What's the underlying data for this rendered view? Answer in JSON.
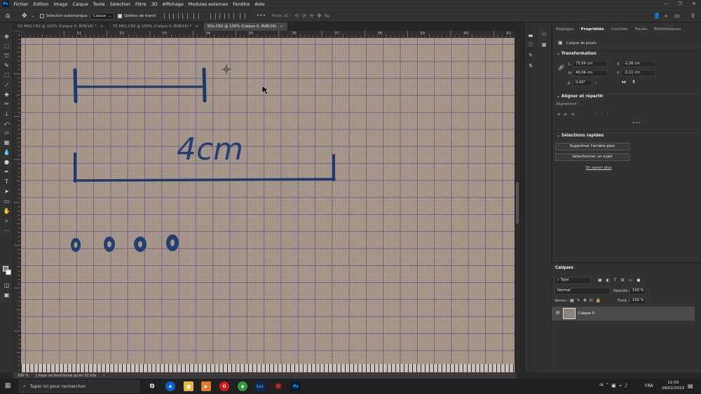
{
  "menu": [
    "Fichier",
    "Edition",
    "Image",
    "Calque",
    "Texte",
    "Sélection",
    "Filtre",
    "3D",
    "Affichage",
    "Modules externes",
    "Fenêtre",
    "Aide"
  ],
  "app_logo": "Ps",
  "options": {
    "auto_select_label": "Sélection automatique :",
    "auto_select_value": "Calque",
    "transform_label": "Options de transf.",
    "more": "•••",
    "mode3d_label": "Mode 3D :"
  },
  "tabs": [
    {
      "label": "5D MK2.CR2 @ 100% (Calque 0, RVB/16) *",
      "close": "×"
    },
    {
      "label": "7D MK2.CR2 @ 100% (Calque 0, RVB/16) *",
      "close": "×"
    },
    {
      "label": "5Ds.CR2 @ 100% (Calque 0, RVB/16)",
      "close": "×",
      "active": true
    }
  ],
  "ruler_labels": [
    "31",
    "32",
    "33",
    "34",
    "35",
    "36",
    "37",
    "38",
    "39",
    "40",
    "41"
  ],
  "canvas_text": "4cm",
  "status": {
    "zoom": "100 %",
    "message": "L'expo ne fonctionne qu'en 32 bits"
  },
  "panel_tabs": [
    "Réglages",
    "Propriétés",
    "Couches",
    "Tracés",
    "Bibliothèques"
  ],
  "properties": {
    "kind": "Calque de pixels",
    "transform_title": "Transformation",
    "W_label": "L",
    "W": "73,56 cm",
    "H_label": "H",
    "H": "49,04 cm",
    "X_label": "X",
    "X": "-2,26 cm",
    "Y_label": "Y",
    "Y": "-3,11 cm",
    "angle": "0,00°",
    "align_title": "Aligner et répartir",
    "align_label": "Alignement :",
    "quick_title": "Sélections rapides",
    "btn_remove_bg": "Supprimer l'arrière-plan",
    "btn_select_subject": "Sélectionner un sujet",
    "learn_more": "En savoir plus",
    "ellipsis": "•••"
  },
  "layers": {
    "title": "Calques",
    "filter": "Type",
    "blend": "Normal",
    "opacity_label": "Opacité :",
    "opacity": "100 %",
    "lock_label": "Verrou :",
    "fill_label": "Fond :",
    "fill": "100 %",
    "layer_name": "Calque 0"
  },
  "taskbar": {
    "search_placeholder": "Taper ici pour rechercher",
    "lang": "FRA",
    "time": "12:03",
    "date": "28/02/2023"
  },
  "colors": {
    "accent": "#31a8ff",
    "ink": "#1d3a6b",
    "grid": "#5f5082"
  }
}
